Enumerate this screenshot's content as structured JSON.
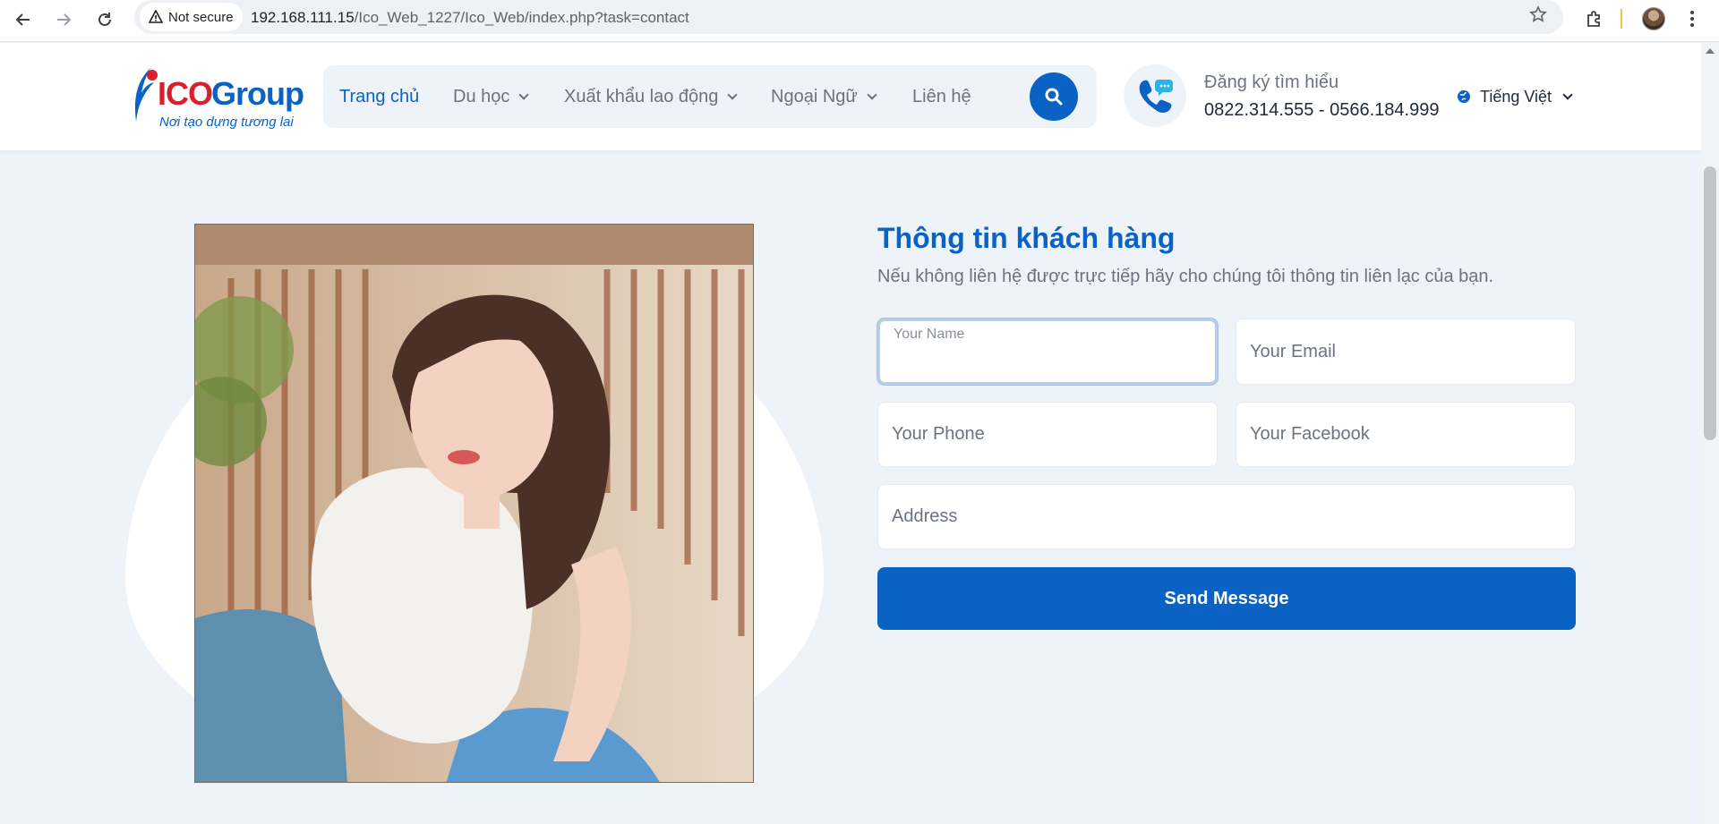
{
  "browser": {
    "secure_label": "Not secure",
    "url_host": "192.168.111.15",
    "url_path": "/Ico_Web_1227/Ico_Web/index.php?task=contact"
  },
  "logo": {
    "part1": "ICO",
    "part2": "Group",
    "tagline": "Nơi tạo dựng tương lai"
  },
  "nav": {
    "items": [
      {
        "label": "Trang chủ",
        "active": true,
        "dropdown": false
      },
      {
        "label": "Du học",
        "active": false,
        "dropdown": true
      },
      {
        "label": "Xuất khẩu lao động",
        "active": false,
        "dropdown": true
      },
      {
        "label": "Ngoại Ngữ",
        "active": false,
        "dropdown": true
      },
      {
        "label": "Liên hệ",
        "active": false,
        "dropdown": false
      }
    ]
  },
  "contact": {
    "register_label": "Đăng ký tìm hiểu",
    "phones": "0822.314.555 - 0566.184.999"
  },
  "language": {
    "selected": "Tiếng Việt"
  },
  "form": {
    "title": "Thông tin khách hàng",
    "subtitle": "Nếu không liên hệ được trực tiếp hãy cho chúng tôi thông tin liên lạc của bạn.",
    "name_placeholder": "Your Name",
    "email_placeholder": "Your Email",
    "phone_placeholder": "Your Phone",
    "facebook_placeholder": "Your Facebook",
    "address_placeholder": "Address",
    "submit_label": "Send Message"
  },
  "colors": {
    "primary": "#0a62c4",
    "page_bg": "#eef3f9",
    "brand_red": "#d81f2b"
  }
}
